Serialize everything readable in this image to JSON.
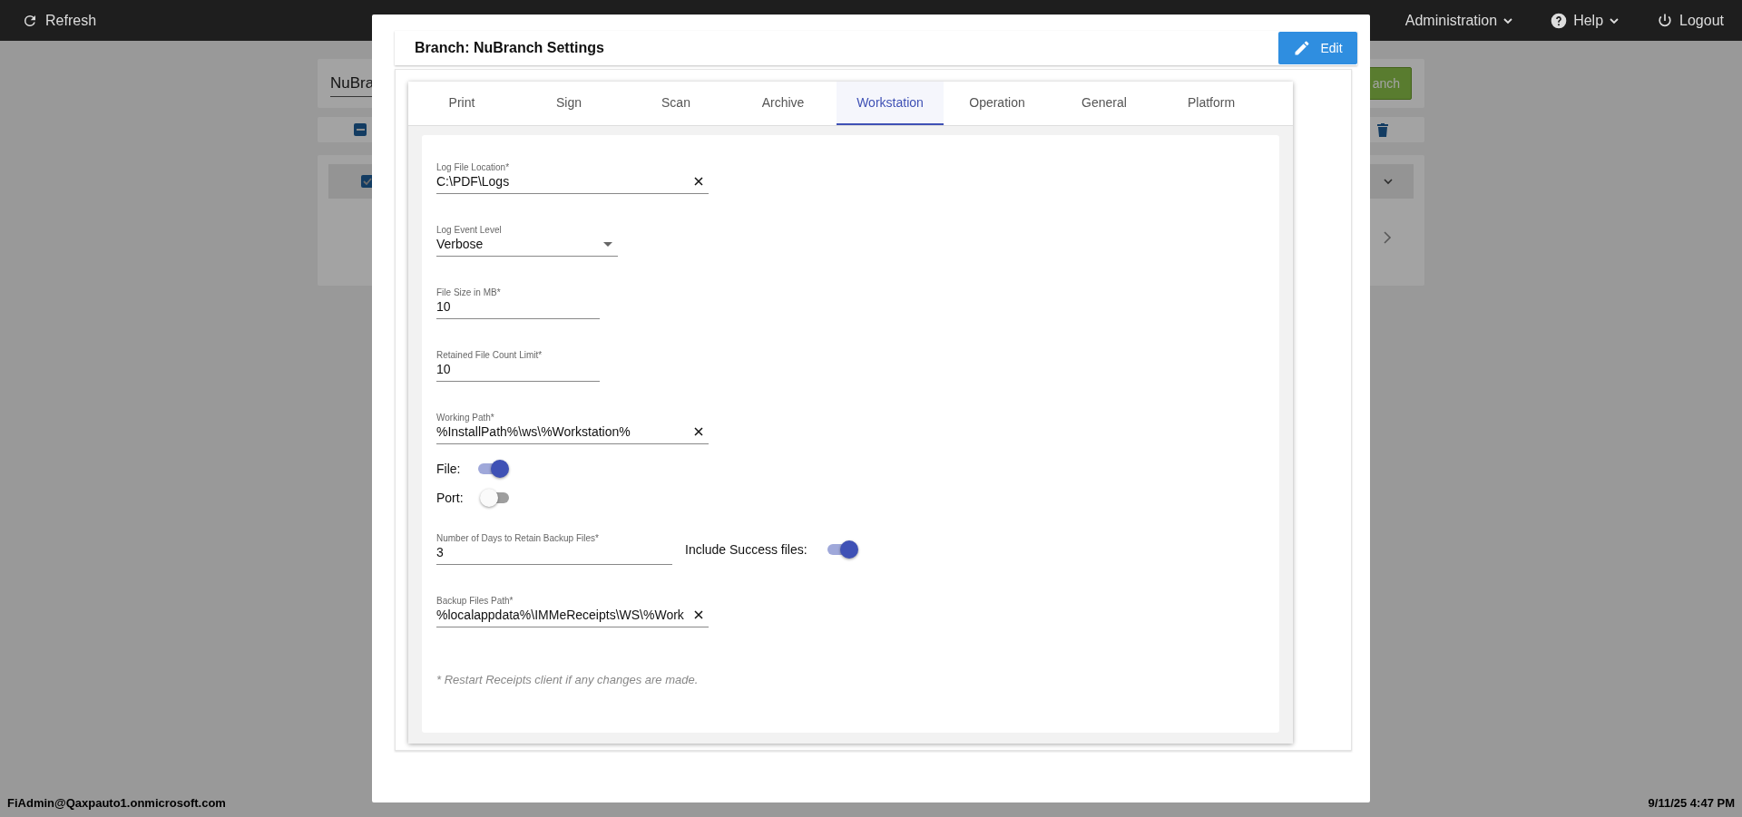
{
  "top_bar": {
    "refresh": "Refresh",
    "menus": [
      {
        "label": "Administration",
        "kind": "dropdown"
      },
      {
        "label": "Help",
        "kind": "help"
      },
      {
        "label": "Logout",
        "kind": "logout"
      }
    ]
  },
  "background": {
    "search_value": "NuBra",
    "action_button": "anch",
    "select_all": {
      "indeterminate": true
    },
    "branch_row": {
      "checked": true
    }
  },
  "status_bar": {
    "user": "FiAdmin@Qaxpauto1.onmicrosoft.com",
    "datetime": "9/11/25 4:47 PM"
  },
  "dialog": {
    "title": "Branch: NuBranch Settings",
    "edit_button": "Edit",
    "tabs": [
      {
        "label": "Print",
        "selected": false
      },
      {
        "label": "Sign",
        "selected": false
      },
      {
        "label": "Scan",
        "selected": false
      },
      {
        "label": "Archive",
        "selected": false
      },
      {
        "label": "Workstation",
        "selected": true
      },
      {
        "label": "Operation",
        "selected": false
      },
      {
        "label": "General",
        "selected": false
      },
      {
        "label": "Platform",
        "selected": false
      }
    ],
    "fields": [
      {
        "kind": "text",
        "label": "Log File Location*",
        "value": "C:\\PDF\\Logs",
        "clearable": true
      },
      {
        "kind": "select",
        "label": "Log Event Level",
        "value": "Verbose"
      },
      {
        "kind": "text",
        "label": "File Size in MB*",
        "value": "10",
        "clearable": false
      },
      {
        "kind": "text",
        "label": "Retained File Count Limit*",
        "value": "10",
        "clearable": false
      },
      {
        "kind": "text",
        "label": "Working Path*",
        "value": "%InstallPath%\\ws\\%Workstation%",
        "clearable": true
      },
      {
        "kind": "toggle",
        "label": "File:",
        "on": true
      },
      {
        "kind": "toggle",
        "label": "Port:",
        "on": false
      },
      {
        "kind": "text",
        "label": "Number of Days to Retain Backup Files*",
        "value": "3",
        "clearable": false,
        "toggle": {
          "label": "Include Success files:",
          "on": true
        }
      },
      {
        "kind": "text",
        "label": "Backup Files Path*",
        "value": "%localappdata%\\IMMeReceipts\\WS\\%Work",
        "clearable": true
      }
    ],
    "note": "* Restart Receipts client if any changes are made."
  }
}
